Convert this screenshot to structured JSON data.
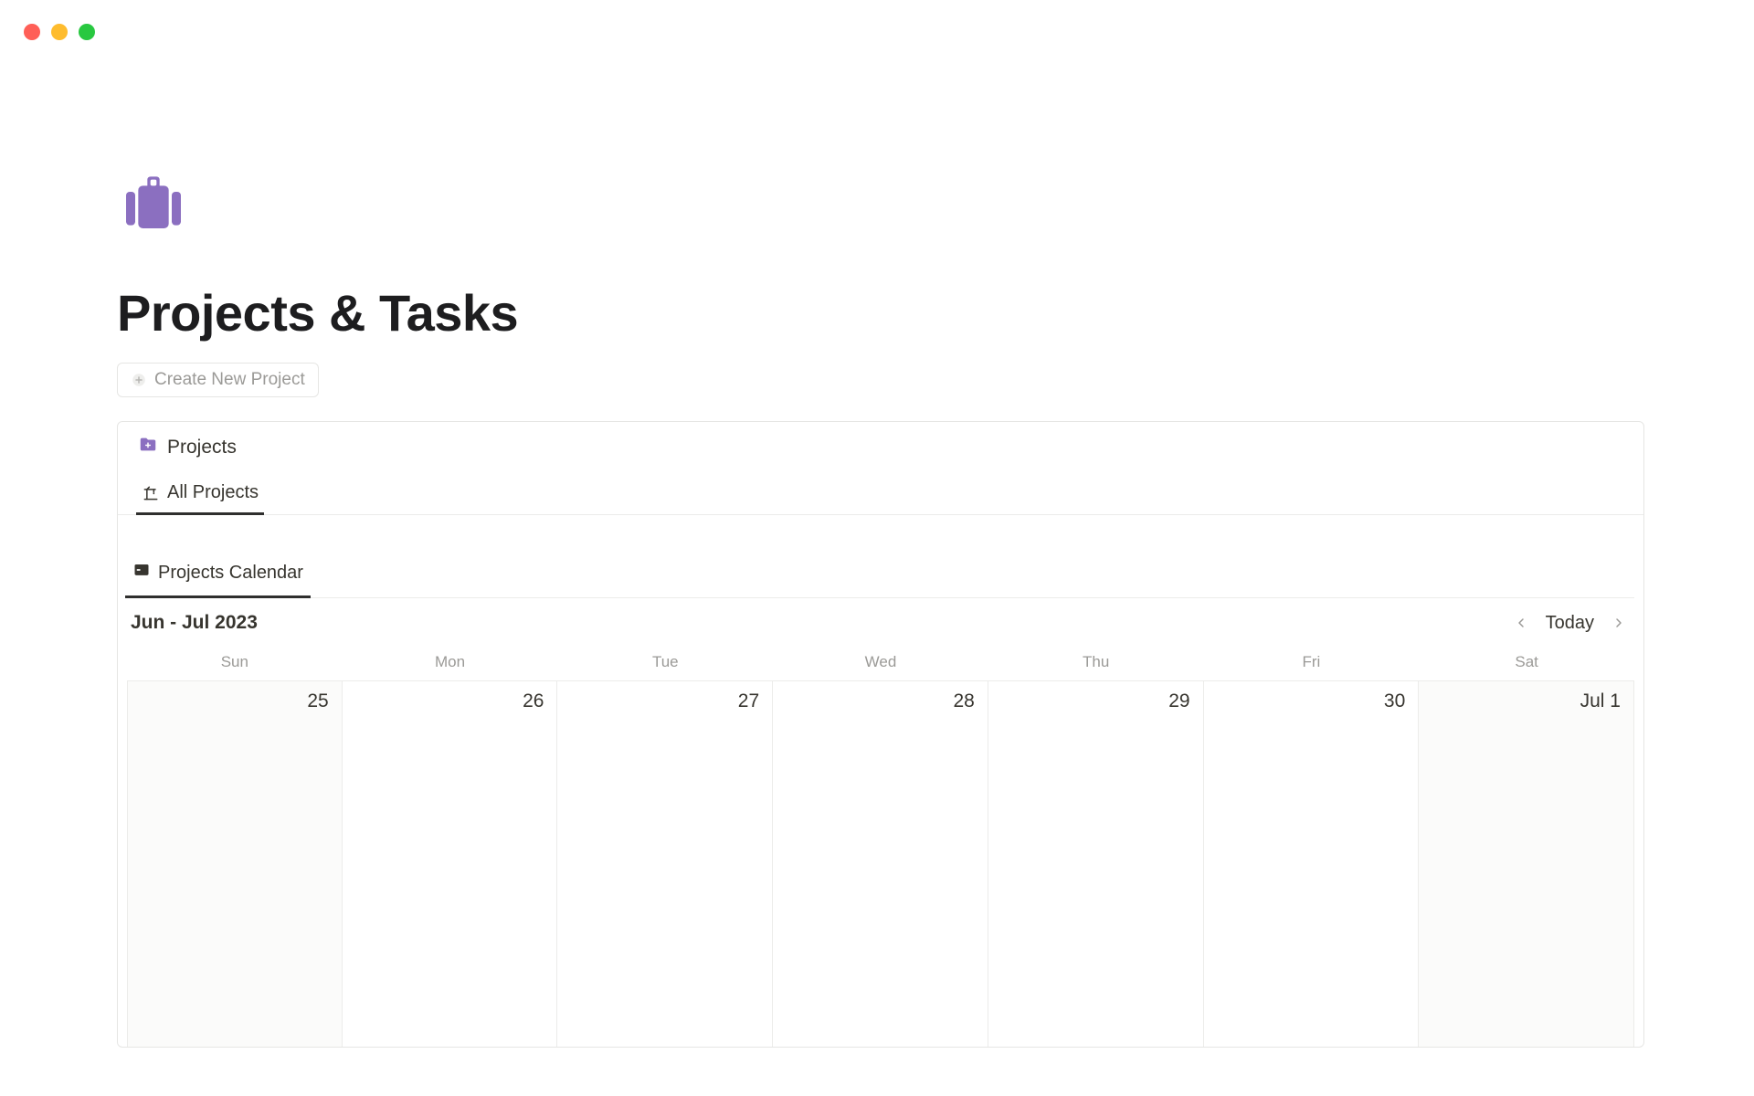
{
  "colors": {
    "accent": "#8b6fc0",
    "text": "#37352f",
    "muted": "#9b9a97",
    "border": "#ececea",
    "weekend_bg": "#fbfbfa"
  },
  "page": {
    "title": "Projects & Tasks",
    "create_button_label": "Create New Project"
  },
  "projects_section": {
    "heading": "Projects",
    "tabs": [
      {
        "label": "All Projects",
        "icon": "crane-icon",
        "active": true
      }
    ]
  },
  "calendar_view": {
    "tabs": [
      {
        "label": "Projects Calendar",
        "icon": "card-box-icon",
        "active": true
      }
    ],
    "range_label": "Jun - Jul 2023",
    "today_label": "Today",
    "day_names": [
      "Sun",
      "Mon",
      "Tue",
      "Wed",
      "Thu",
      "Fri",
      "Sat"
    ],
    "days": [
      {
        "label": "25",
        "weekend": true
      },
      {
        "label": "26",
        "weekend": false
      },
      {
        "label": "27",
        "weekend": false
      },
      {
        "label": "28",
        "weekend": false
      },
      {
        "label": "29",
        "weekend": false
      },
      {
        "label": "30",
        "weekend": false
      },
      {
        "label": "Jul 1",
        "weekend": true
      }
    ]
  }
}
